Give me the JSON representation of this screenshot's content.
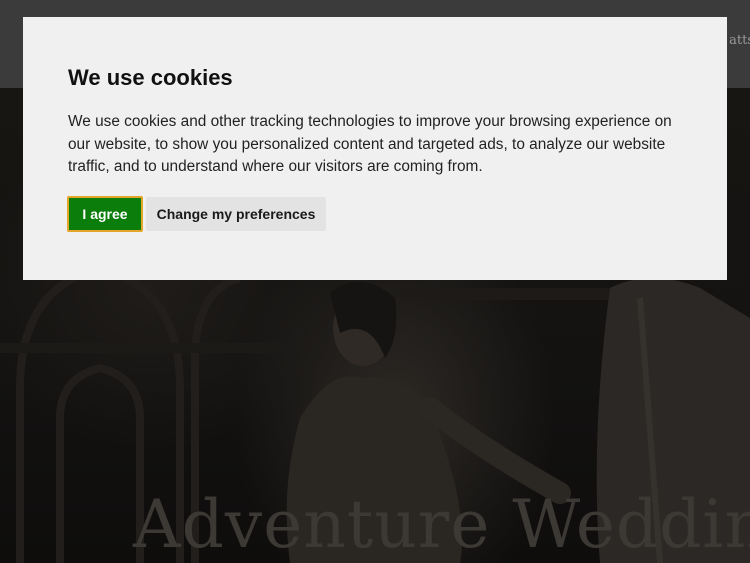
{
  "site": {
    "header_fragment": "atts",
    "hero_title": "Adventure Weddings"
  },
  "cookie_banner": {
    "title": "We use cookies",
    "text": "We use cookies and other tracking technologies to improve your browsing experience on our website, to show you personalized content and targeted ads, to analyze our website traffic, and to understand where our visitors are coming from.",
    "agree_label": "I agree",
    "preferences_label": "Change my preferences"
  },
  "colors": {
    "agree_bg": "#0a7d0a",
    "agree_border": "#e3a52a",
    "dialog_bg": "#f0f0f0",
    "header_bg": "#3b3b3b"
  }
}
